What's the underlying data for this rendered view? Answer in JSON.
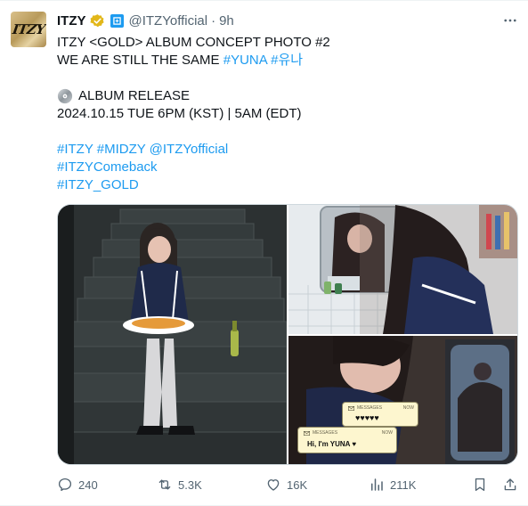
{
  "tweet": {
    "author_name": "ITZY",
    "handle": "@ITZYofficial",
    "separator": "·",
    "time": "9h",
    "avatar_text": "ITZY",
    "line1": "ITZY <GOLD> ALBUM CONCEPT PHOTO #2",
    "line2_text": "WE ARE STILL THE SAME",
    "line2_tag1": "#YUNA",
    "line2_tag2": "#유나",
    "release_label": "ALBUM RELEASE",
    "release_date": "2024.10.15 TUE 6PM (KST) | 5AM (EDT)",
    "tags_row1": [
      "#ITZY",
      "#MIDZY",
      "@ITZYofficial"
    ],
    "tag_comeback": "#ITZYComeback",
    "tag_gold": "#ITZY_GOLD"
  },
  "media": {
    "message_label": "MESSAGES",
    "message_time": "NOW",
    "message_1": "♥♥♥♥♥",
    "message_2": "Hi, I'm YUNA ♥"
  },
  "actions": {
    "replies": "240",
    "reposts": "5.3K",
    "likes": "16K",
    "views": "211K"
  },
  "colors": {
    "accent": "#1d9bf0",
    "muted": "#536471",
    "verified_gold": "#e2b719"
  },
  "icons": [
    "verified-gold-icon",
    "affiliate-badge-icon",
    "more-icon",
    "disc-icon",
    "reply-icon",
    "repost-icon",
    "like-icon",
    "views-icon",
    "bookmark-icon",
    "share-icon"
  ]
}
